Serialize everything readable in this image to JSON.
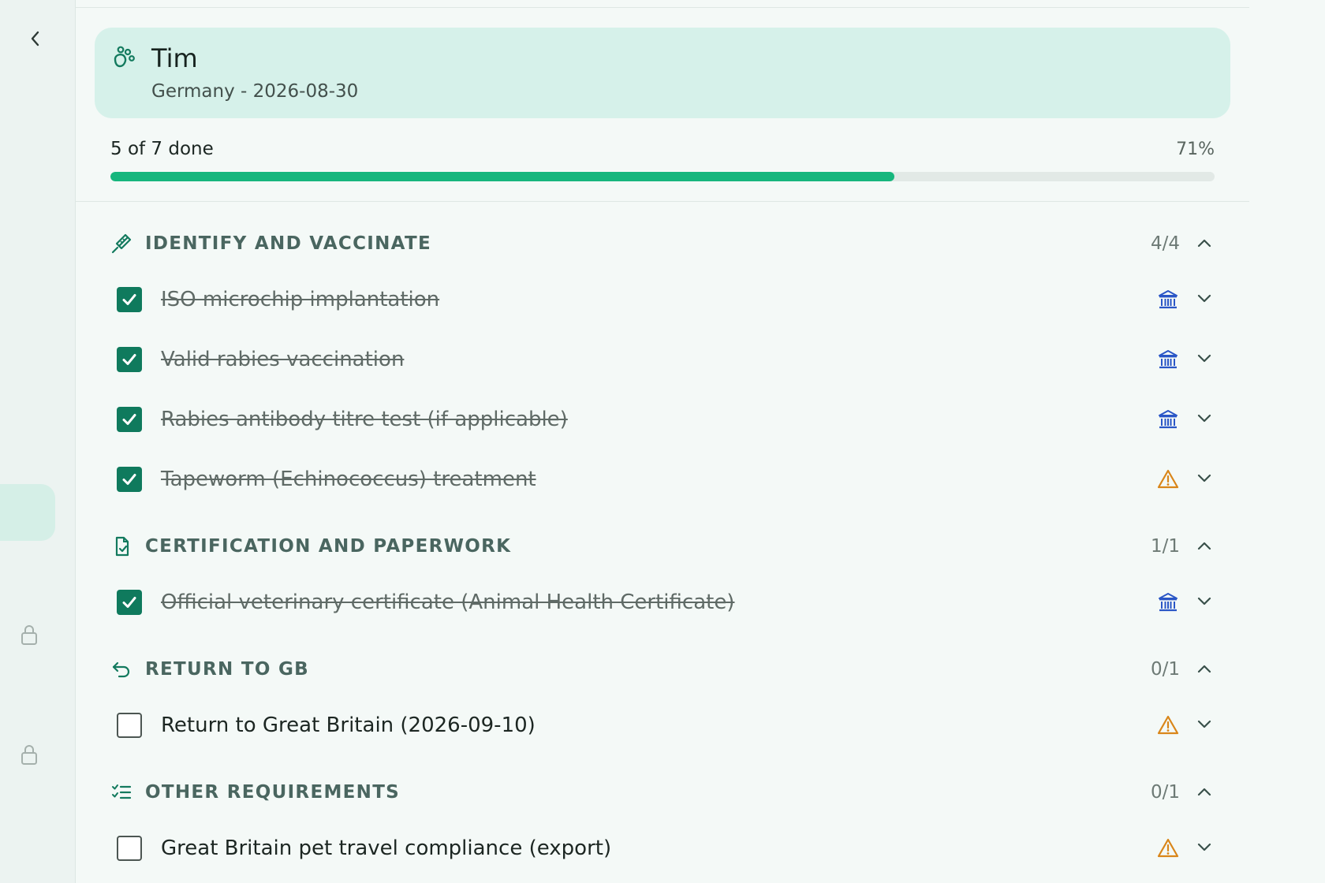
{
  "pet": {
    "name": "Tim",
    "meta": "Germany - 2026-08-30"
  },
  "progress": {
    "label": "5 of 7 done",
    "percent_label": "71%",
    "fraction": 0.71
  },
  "colors": {
    "accent": "#17b67d",
    "check_fill": "#0f7a5d",
    "gov_icon": "#2a56c6",
    "warning_icon": "#d9861a",
    "card_bg": "#d6f1ea"
  },
  "sections": [
    {
      "title": "IDENTIFY AND VACCINATE",
      "count": "4/4",
      "icon": "syringe-icon",
      "items": [
        {
          "label": "ISO microchip implantation",
          "checked": true,
          "type_icon": "government-building-icon"
        },
        {
          "label": "Valid rabies vaccination",
          "checked": true,
          "type_icon": "government-building-icon"
        },
        {
          "label": "Rabies antibody titre test (if applicable)",
          "checked": true,
          "type_icon": "government-building-icon"
        },
        {
          "label": "Tapeworm (Echinococcus) treatment",
          "checked": true,
          "type_icon": "warning-icon"
        }
      ]
    },
    {
      "title": "CERTIFICATION AND PAPERWORK",
      "count": "1/1",
      "icon": "document-check-icon",
      "items": [
        {
          "label": "Official veterinary certificate (Animal Health Certificate)",
          "checked": true,
          "type_icon": "government-building-icon"
        }
      ]
    },
    {
      "title": "RETURN TO GB",
      "count": "0/1",
      "icon": "return-arrow-icon",
      "items": [
        {
          "label": "Return to Great Britain (2026-09-10)",
          "checked": false,
          "type_icon": "warning-icon"
        }
      ]
    },
    {
      "title": "OTHER REQUIREMENTS",
      "count": "0/1",
      "icon": "checklist-icon",
      "items": [
        {
          "label": "Great Britain pet travel compliance (export)",
          "checked": false,
          "type_icon": "warning-icon"
        }
      ]
    }
  ]
}
